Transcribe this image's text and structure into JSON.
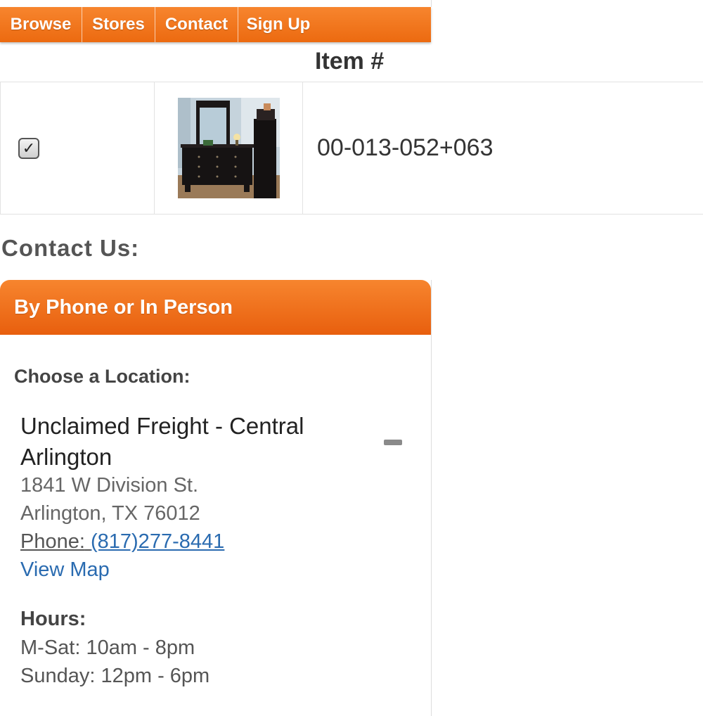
{
  "nav": {
    "items": [
      {
        "label": "Browse"
      },
      {
        "label": "Stores"
      },
      {
        "label": "Contact"
      },
      {
        "label": "Sign Up"
      }
    ]
  },
  "item_table": {
    "header": "Item #",
    "row": {
      "checked": true,
      "item_number": "00-013-052+063",
      "image": "dresser-with-mirror-photo"
    }
  },
  "contact": {
    "title": "Contact Us:",
    "panel_title": "By Phone or In Person",
    "choose_label": "Choose a Location:",
    "location": {
      "name": "Unclaimed Freight - Central Arlington",
      "address_line1": "1841 W Division St.",
      "address_line2": "Arlington, TX 76012",
      "phone_label": "Phone:",
      "phone_number": "(817)277-8441",
      "map_link": "View Map",
      "hours_label": "Hours:",
      "hours_weekday": "M-Sat: 10am - 8pm",
      "hours_sunday": "Sunday: 12pm - 6pm"
    }
  },
  "colors": {
    "accent_orange": "#f07318",
    "link_blue": "#2a6bb0"
  }
}
